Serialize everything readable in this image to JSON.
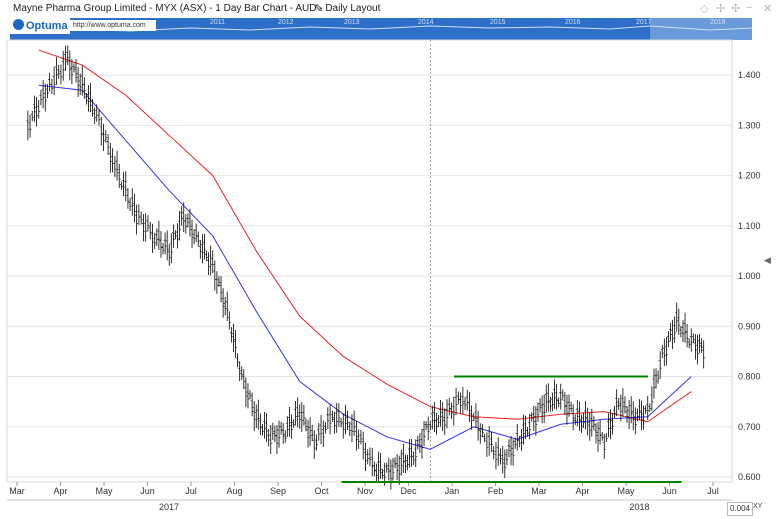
{
  "window": {
    "title": "Mayne Pharma Group Limited - MYX (ASX) - 1 Day Bar Chart - AUD - Daily Layout"
  },
  "navigator": {
    "logo_text": "Optuma",
    "url_text": "http://www.optuma.com",
    "years": [
      "2011",
      "2012",
      "2013",
      "2014",
      "2015",
      "2016",
      "2017",
      "2018"
    ]
  },
  "footer": {
    "scale_value": "0.004",
    "xy_label": "XY"
  },
  "icons": {
    "edit": "pencil-icon",
    "toolbar": [
      "diamond-icon",
      "pin-icon",
      "link-icon",
      "minimize-icon",
      "close-icon"
    ]
  },
  "colors": {
    "price_bars": "#000000",
    "ma_short": "#3333ee",
    "ma_long": "#ee2222",
    "trendlines": "#008000",
    "nav_band": "#2e6fc9"
  },
  "chart_data": {
    "type": "line",
    "title": "Mayne Pharma Group Limited - MYX (ASX) - 1 Day Bar Chart - AUD - Daily Layout",
    "x_ticks": [
      "Mar",
      "Apr",
      "May",
      "Jun",
      "Jul",
      "Aug",
      "Sep",
      "Oct",
      "Nov",
      "Dec",
      "Jan",
      "Feb",
      "Mar",
      "Apr",
      "May",
      "Jun",
      "Jul"
    ],
    "x_year_labels": [
      "2017",
      "2018"
    ],
    "y_ticks": [
      "1.400",
      "1.300",
      "1.200",
      "1.100",
      "1.000",
      "0.900",
      "0.800",
      "0.700",
      "0.600"
    ],
    "ylim": [
      0.59,
      1.47
    ],
    "grid": true,
    "price_series": [
      {
        "month": "Mar 2017",
        "value": 1.3
      },
      {
        "month": "Mar 2017",
        "value": 1.38
      },
      {
        "month": "Apr 2017",
        "value": 1.43
      },
      {
        "month": "Apr 2017",
        "value": 1.38
      },
      {
        "month": "Apr 2017",
        "value": 1.32
      },
      {
        "month": "May 2017",
        "value": 1.22
      },
      {
        "month": "May 2017",
        "value": 1.12
      },
      {
        "month": "Jun 2017",
        "value": 1.08
      },
      {
        "month": "Jun 2017",
        "value": 1.05
      },
      {
        "month": "Jun 2017",
        "value": 1.12
      },
      {
        "month": "Jul 2017",
        "value": 1.07
      },
      {
        "month": "Jul 2017",
        "value": 1.02
      },
      {
        "month": "Jul 2017",
        "value": 0.93
      },
      {
        "month": "Aug 2017",
        "value": 0.8
      },
      {
        "month": "Aug 2017",
        "value": 0.72
      },
      {
        "month": "Aug 2017",
        "value": 0.68
      },
      {
        "month": "Sep 2017",
        "value": 0.69
      },
      {
        "month": "Sep 2017",
        "value": 0.73
      },
      {
        "month": "Sep 2017",
        "value": 0.67
      },
      {
        "month": "Oct 2017",
        "value": 0.72
      },
      {
        "month": "Oct 2017",
        "value": 0.7
      },
      {
        "month": "Nov 2017",
        "value": 0.62
      },
      {
        "month": "Nov 2017",
        "value": 0.61
      },
      {
        "month": "Nov 2017",
        "value": 0.625
      },
      {
        "month": "Dec 2017",
        "value": 0.65
      },
      {
        "month": "Dec 2017",
        "value": 0.71
      },
      {
        "month": "Dec 2017",
        "value": 0.72
      },
      {
        "month": "Jan 2018",
        "value": 0.76
      },
      {
        "month": "Jan 2018",
        "value": 0.68
      },
      {
        "month": "Feb 2018",
        "value": 0.63
      },
      {
        "month": "Feb 2018",
        "value": 0.67
      },
      {
        "month": "Feb 2018",
        "value": 0.71
      },
      {
        "month": "Mar 2018",
        "value": 0.75
      },
      {
        "month": "Mar 2018",
        "value": 0.76
      },
      {
        "month": "Mar 2018",
        "value": 0.72
      },
      {
        "month": "Apr 2018",
        "value": 0.71
      },
      {
        "month": "Apr 2018",
        "value": 0.67
      },
      {
        "month": "Apr 2018",
        "value": 0.75
      },
      {
        "month": "May 2018",
        "value": 0.72
      },
      {
        "month": "May 2018",
        "value": 0.73
      },
      {
        "month": "May 2018",
        "value": 0.84
      },
      {
        "month": "Jun 2018",
        "value": 0.91
      },
      {
        "month": "Jun 2018",
        "value": 0.87
      },
      {
        "month": "Jun 2018",
        "value": 0.85
      }
    ],
    "ma_short": [
      {
        "month": "Mar 2017",
        "value": 1.38
      },
      {
        "month": "Apr 2017",
        "value": 1.37
      },
      {
        "month": "May 2017",
        "value": 1.27
      },
      {
        "month": "Jun 2017",
        "value": 1.17
      },
      {
        "month": "Jul 2017",
        "value": 1.08
      },
      {
        "month": "Aug 2017",
        "value": 0.93
      },
      {
        "month": "Sep 2017",
        "value": 0.79
      },
      {
        "month": "Oct 2017",
        "value": 0.725
      },
      {
        "month": "Nov 2017",
        "value": 0.68
      },
      {
        "month": "Dec 2017",
        "value": 0.655
      },
      {
        "month": "Jan 2018",
        "value": 0.7
      },
      {
        "month": "Feb 2018",
        "value": 0.675
      },
      {
        "month": "Mar 2018",
        "value": 0.705
      },
      {
        "month": "Apr 2018",
        "value": 0.715
      },
      {
        "month": "May 2018",
        "value": 0.72
      },
      {
        "month": "Jun 2018",
        "value": 0.8
      }
    ],
    "ma_long": [
      {
        "month": "Mar 2017",
        "value": 1.45
      },
      {
        "month": "Apr 2017",
        "value": 1.42
      },
      {
        "month": "May 2017",
        "value": 1.36
      },
      {
        "month": "Jun 2017",
        "value": 1.28
      },
      {
        "month": "Jul 2017",
        "value": 1.2
      },
      {
        "month": "Aug 2017",
        "value": 1.05
      },
      {
        "month": "Sep 2017",
        "value": 0.92
      },
      {
        "month": "Oct 2017",
        "value": 0.84
      },
      {
        "month": "Nov 2017",
        "value": 0.785
      },
      {
        "month": "Dec 2017",
        "value": 0.74
      },
      {
        "month": "Jan 2018",
        "value": 0.72
      },
      {
        "month": "Feb 2018",
        "value": 0.715
      },
      {
        "month": "Mar 2018",
        "value": 0.725
      },
      {
        "month": "Apr 2018",
        "value": 0.73
      },
      {
        "month": "May 2018",
        "value": 0.71
      },
      {
        "month": "Jun 2018",
        "value": 0.77
      }
    ],
    "horizontal_lines": [
      {
        "name": "resistance",
        "value": 0.8,
        "from": "Jan 2018",
        "to": "May 2018"
      },
      {
        "name": "support",
        "value": 0.59,
        "from": "Oct 2017",
        "to": "Jun 2018"
      }
    ],
    "cursor_line_month": "Dec 2017"
  }
}
